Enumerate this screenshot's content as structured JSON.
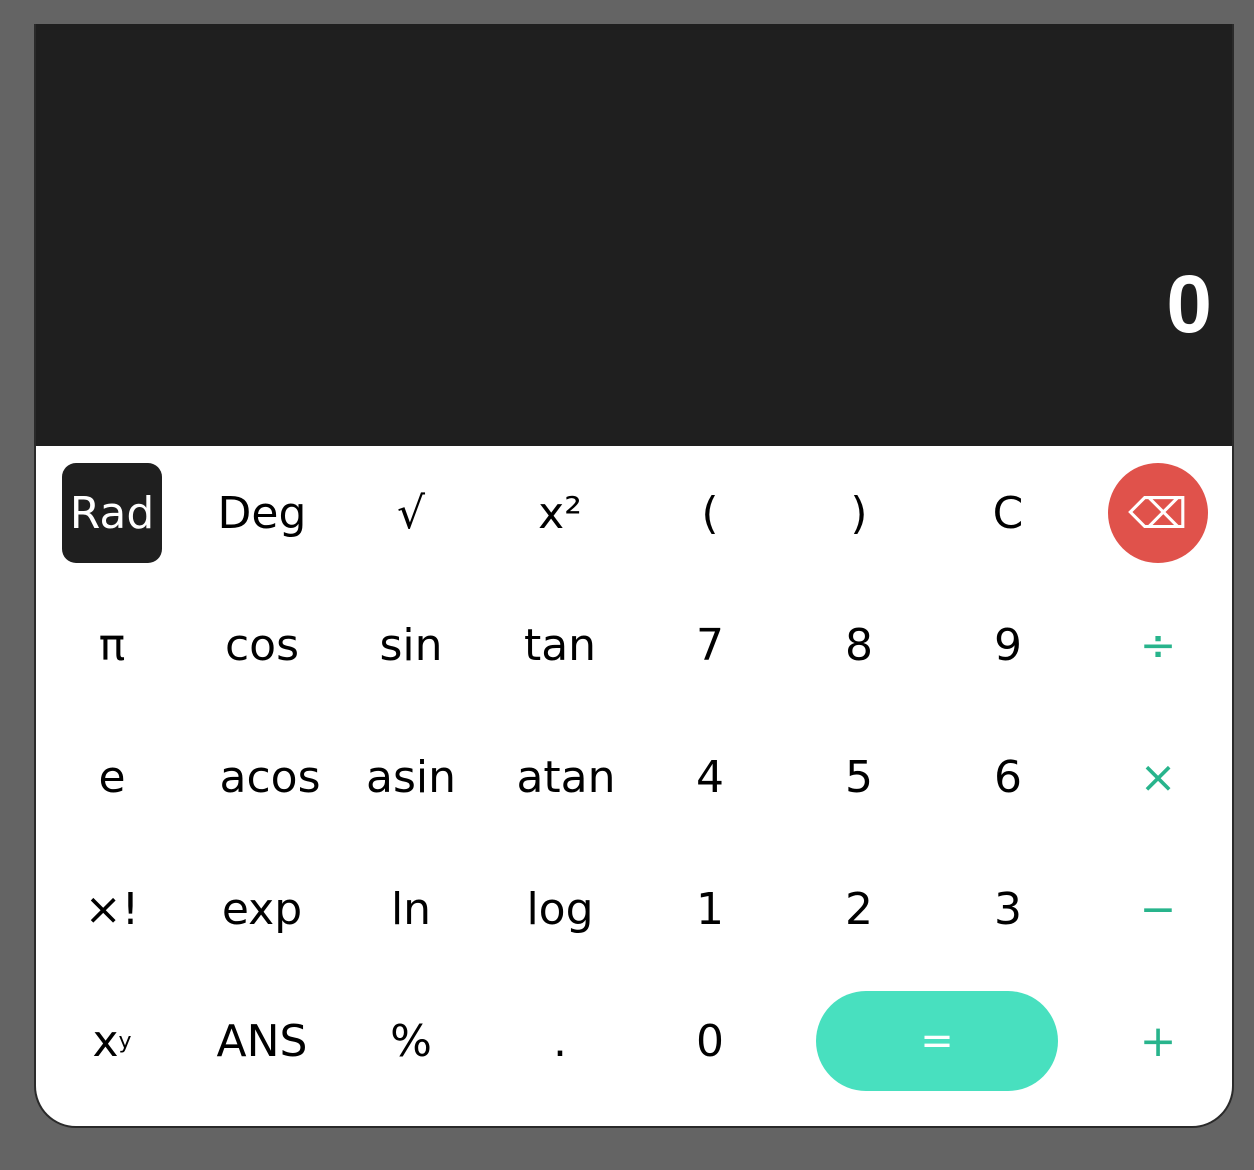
{
  "display": {
    "value": "0"
  },
  "colors": {
    "display_bg": "#1f1f1f",
    "backspace": "#e0524b",
    "equals": "#48e0bf",
    "operator": "#28b48c"
  },
  "keys": {
    "rad": "Rad",
    "deg": "Deg",
    "sqrt": "√",
    "square": "x²",
    "open_paren": "(",
    "close_paren": ")",
    "clear": "C",
    "backspace": "⌫",
    "pi": "π",
    "cos": "cos",
    "sin": "sin",
    "tan": "tan",
    "seven": "7",
    "eight": "8",
    "nine": "9",
    "divide": "÷",
    "e": "e",
    "acos": "acos",
    "asin": "asin",
    "atan": "atan",
    "four": "4",
    "five": "5",
    "six": "6",
    "multiply": "×",
    "factorial": "×!",
    "exp": "exp",
    "ln": "ln",
    "log": "log",
    "one": "1",
    "two": "2",
    "three": "3",
    "minus": "−",
    "power_base": "x",
    "power_exp": "y",
    "ans": "ANS",
    "percent": "%",
    "dot": ".",
    "zero": "0",
    "equals": "=",
    "plus": "+"
  }
}
